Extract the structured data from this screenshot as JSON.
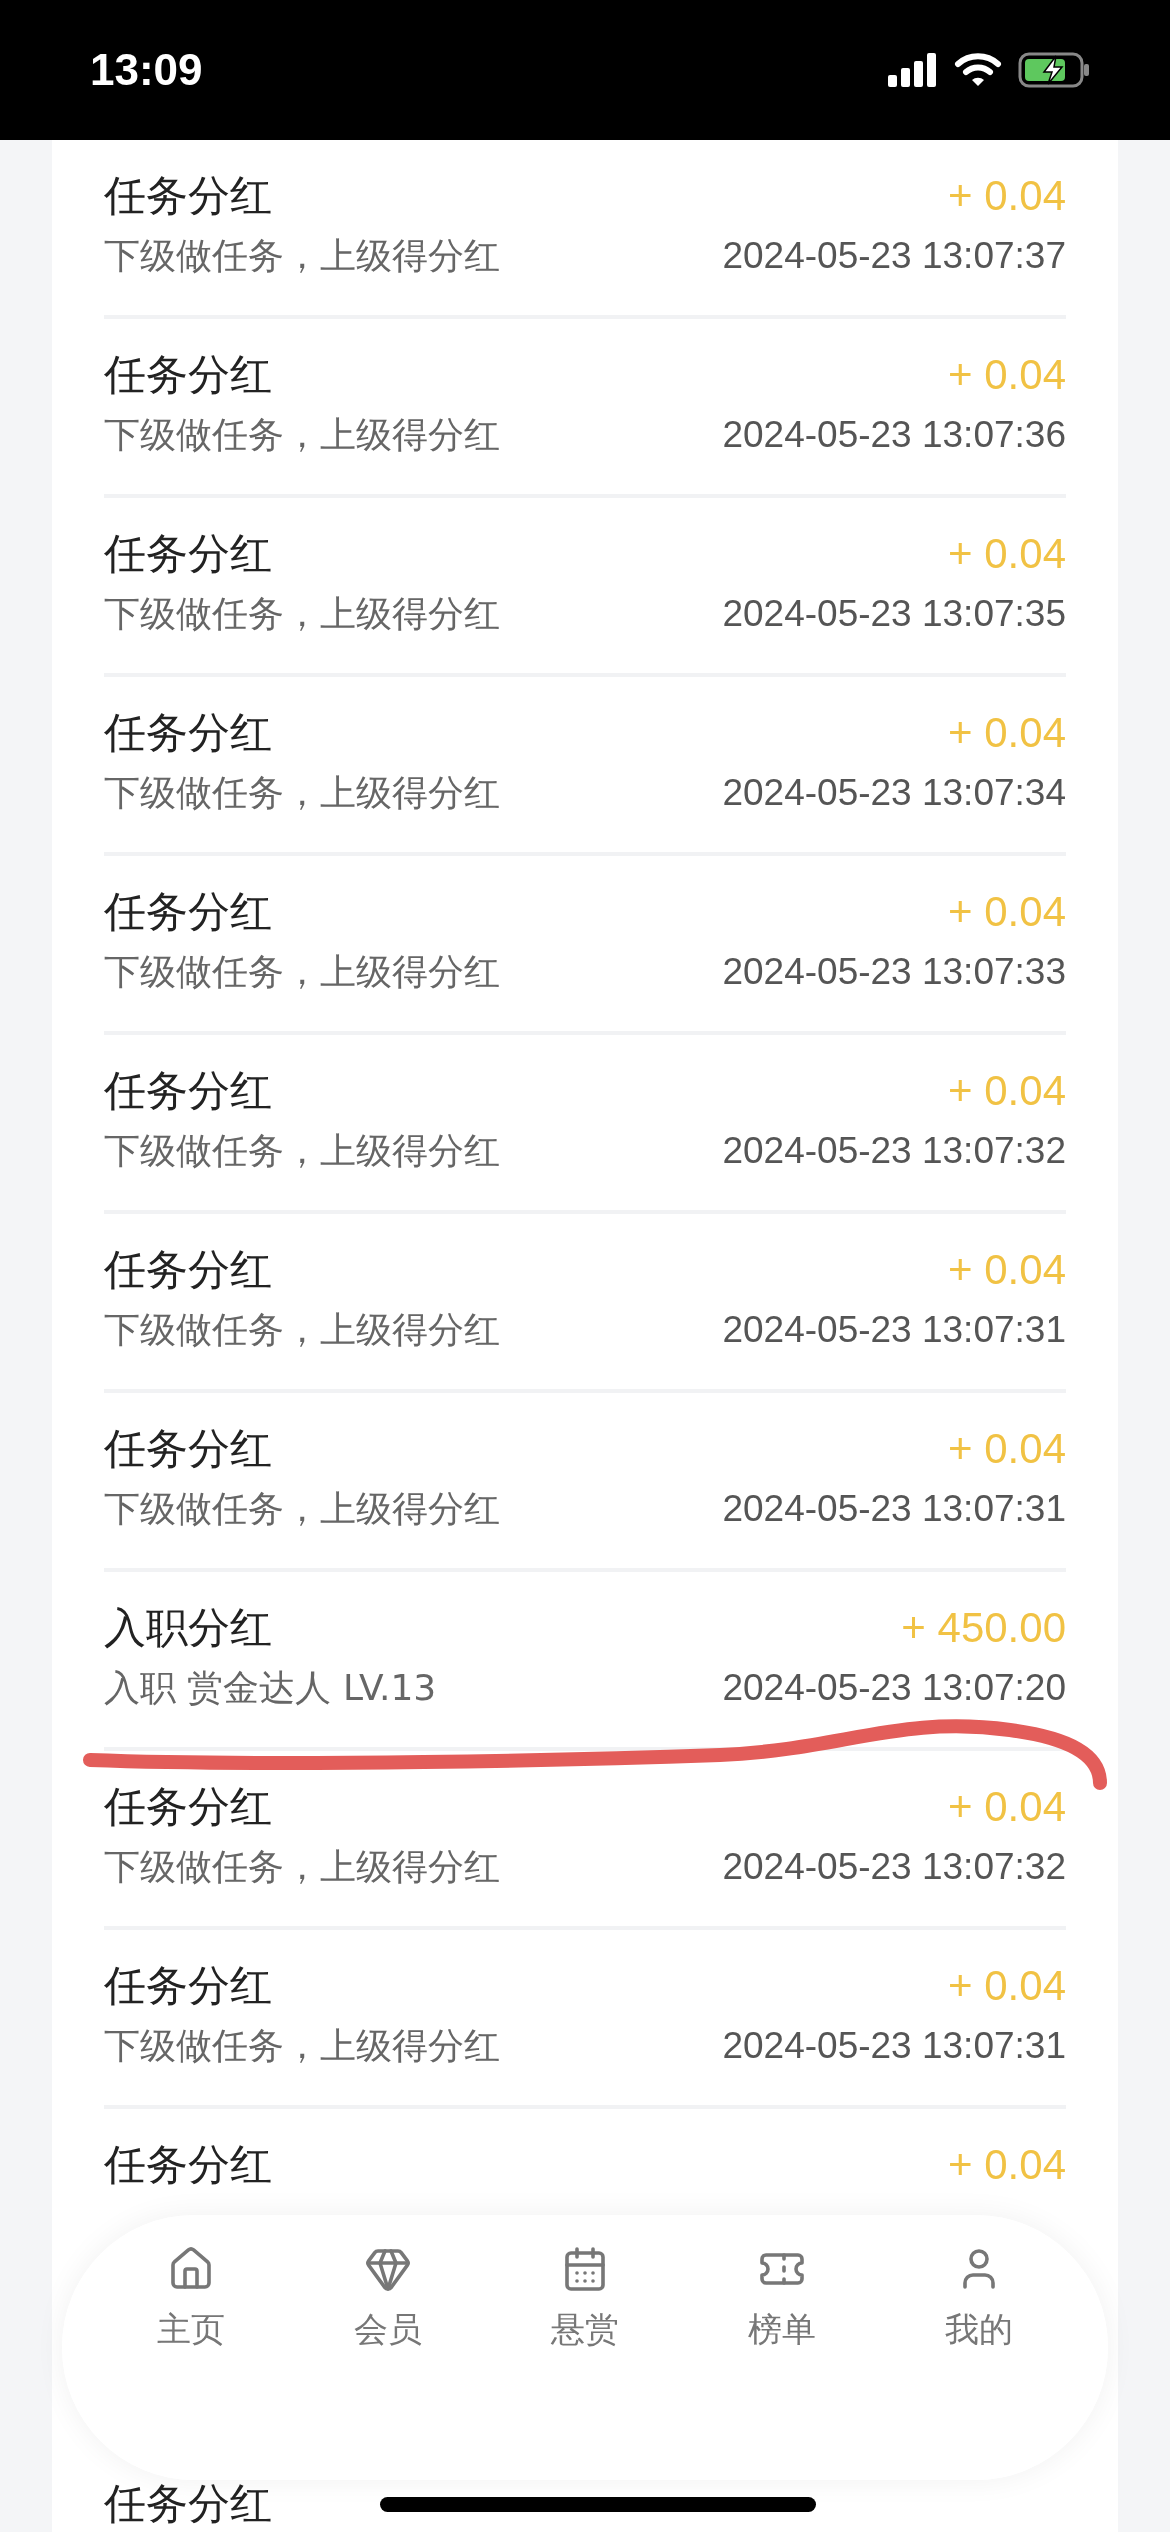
{
  "status_bar": {
    "time": "13:09"
  },
  "records": [
    {
      "title": "任务分红",
      "subtitle": "下级做任务，上级得分红",
      "amount": "+ 0.04",
      "time": "2024-05-23 13:07:37"
    },
    {
      "title": "任务分红",
      "subtitle": "下级做任务，上级得分红",
      "amount": "+ 0.04",
      "time": "2024-05-23 13:07:36"
    },
    {
      "title": "任务分红",
      "subtitle": "下级做任务，上级得分红",
      "amount": "+ 0.04",
      "time": "2024-05-23 13:07:35"
    },
    {
      "title": "任务分红",
      "subtitle": "下级做任务，上级得分红",
      "amount": "+ 0.04",
      "time": "2024-05-23 13:07:34"
    },
    {
      "title": "任务分红",
      "subtitle": "下级做任务，上级得分红",
      "amount": "+ 0.04",
      "time": "2024-05-23 13:07:33"
    },
    {
      "title": "任务分红",
      "subtitle": "下级做任务，上级得分红",
      "amount": "+ 0.04",
      "time": "2024-05-23 13:07:32"
    },
    {
      "title": "任务分红",
      "subtitle": "下级做任务，上级得分红",
      "amount": "+ 0.04",
      "time": "2024-05-23 13:07:31"
    },
    {
      "title": "任务分红",
      "subtitle": "下级做任务，上级得分红",
      "amount": "+ 0.04",
      "time": "2024-05-23 13:07:31"
    },
    {
      "title": "入职分红",
      "subtitle": "入职 赏金达人 LV.13",
      "amount": "+ 450.00",
      "time": "2024-05-23 13:07:20"
    },
    {
      "title": "任务分红",
      "subtitle": "下级做任务，上级得分红",
      "amount": "+ 0.04",
      "time": "2024-05-23 13:07:32"
    },
    {
      "title": "任务分红",
      "subtitle": "下级做任务，上级得分红",
      "amount": "+ 0.04",
      "time": "2024-05-23 13:07:31"
    },
    {
      "title": "任务分红",
      "amount": "+ 0.04"
    },
    {
      "title": "任务分红"
    }
  ],
  "tab_bar": [
    {
      "label": "主页"
    },
    {
      "label": "会员"
    },
    {
      "label": "悬赏"
    },
    {
      "label": "榜单"
    },
    {
      "label": "我的"
    }
  ]
}
